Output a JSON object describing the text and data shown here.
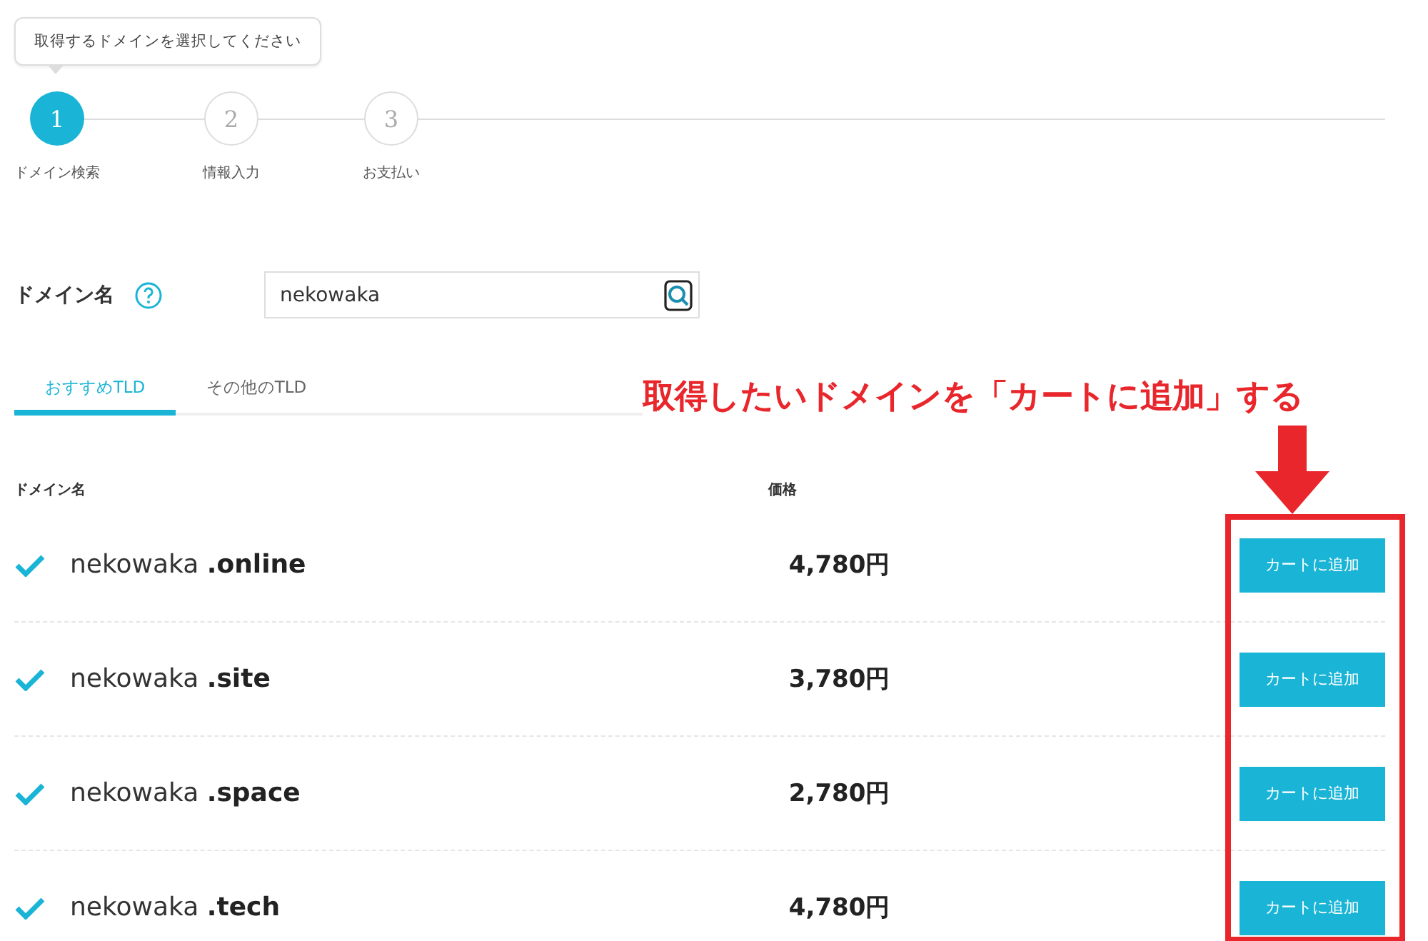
{
  "tooltip": "取得するドメインを選択してください",
  "steps": [
    {
      "number": "1",
      "label": "ドメイン検索",
      "selected": true
    },
    {
      "number": "2",
      "label": "情報入力",
      "selected": false
    },
    {
      "number": "3",
      "label": "お支払い",
      "selected": false
    }
  ],
  "search": {
    "label": "ドメイン名",
    "value": "nekowaka"
  },
  "tabs": [
    {
      "label": "おすすめTLD",
      "selected": true
    },
    {
      "label": "その他のTLD",
      "selected": false
    }
  ],
  "annotation": "取得したいドメインを「カートに追加」する",
  "table": {
    "columns": [
      "ドメイン名",
      "価格"
    ],
    "rows": [
      {
        "checked": true,
        "name": "nekowaka",
        "tld": ".online",
        "price": "4,780円",
        "button": "カートに追加"
      },
      {
        "checked": true,
        "name": "nekowaka",
        "tld": ".site",
        "price": "3,780円",
        "button": "カートに追加"
      },
      {
        "checked": true,
        "name": "nekowaka",
        "tld": ".space",
        "price": "2,780円",
        "button": "カートに追加"
      },
      {
        "checked": true,
        "name": "nekowaka",
        "tld": ".tech",
        "price": "4,780円",
        "button": "カートに追加"
      }
    ]
  }
}
